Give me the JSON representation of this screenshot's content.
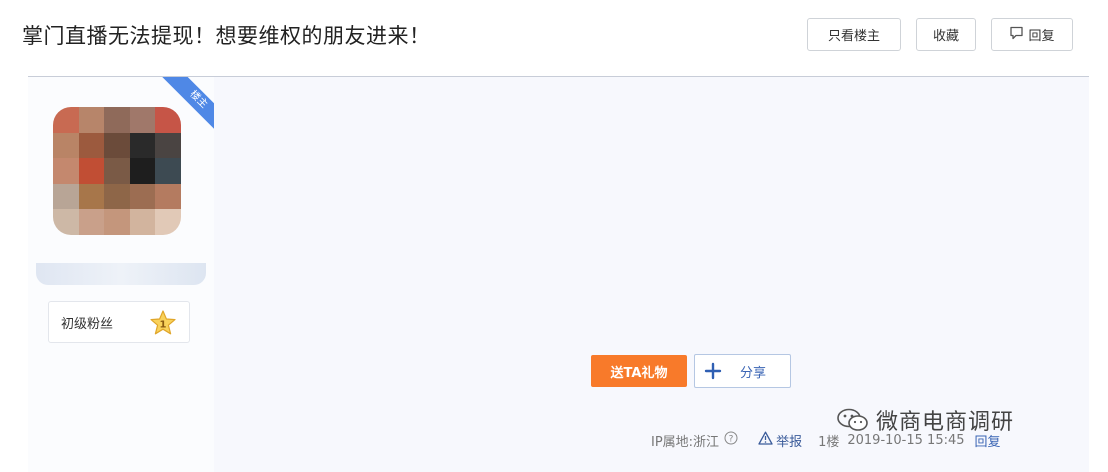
{
  "thread": {
    "title": "掌门直播无法提现！想要维权的朋友进来！"
  },
  "toolbar": {
    "only_op_label": "只看楼主",
    "favorite_label": "收藏",
    "reply_label": "回复"
  },
  "author": {
    "op_badge": "楼主",
    "level_label": "初级粉丝",
    "level_number": "1"
  },
  "actions": {
    "gift_label": "送TA礼物",
    "share_label": "分享"
  },
  "meta": {
    "ip_location": "IP属地:浙江",
    "report_label": "举报",
    "floor": "1楼",
    "timestamp": "2019-10-15 15:45",
    "reply_label": "回复"
  },
  "watermark": {
    "text": "微商电商调研"
  },
  "colors": {
    "accent_blue": "#4f88e6",
    "gift_orange": "#f87a2a",
    "link_blue": "#3a64b4",
    "post_bg": "#f8f9fd"
  }
}
